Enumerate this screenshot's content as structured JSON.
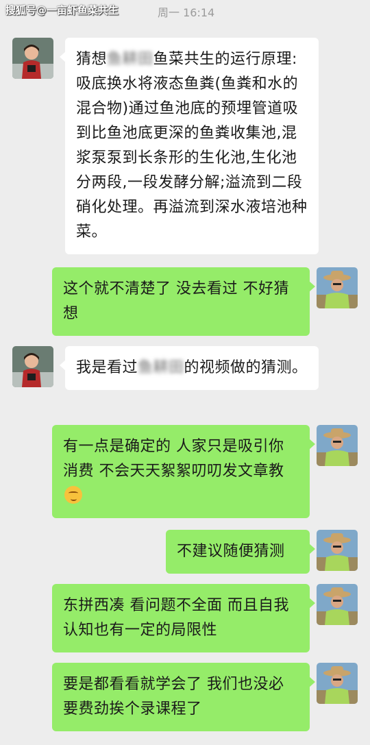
{
  "header": {
    "watermark": "搜狐号@一亩虾鱼菜共生",
    "timestamp": "周一 16:14"
  },
  "messages": [
    {
      "side": "left",
      "avatar": "child-avatar",
      "text_before": "猜想",
      "blurred": "鱼耕田",
      "text_after": "鱼菜共生的运行原理:吸底换水将液态鱼粪(鱼粪和水的混合物)通过鱼池底的预埋管道吸到比鱼池底更深的鱼粪收集池,混浆泵泵到长条形的生化池,生化池分两段,一段发酵分解;溢流到二段硝化处理。再溢流到深水液培池种菜。"
    },
    {
      "side": "right",
      "avatar": "farmer-avatar",
      "text": "这个就不清楚了 没去看过 不好猜想"
    },
    {
      "side": "left",
      "avatar": "child-avatar",
      "text_before": "我是看过",
      "blurred": "鱼耕田",
      "text_after": "的视频做的猜测。"
    },
    {
      "side": "right",
      "avatar": "farmer-avatar",
      "text": "有一点是确定的 人家只是吸引你消费 不会天天絮絮叨叨发文章教",
      "emoji": "thinking-face-emoji"
    },
    {
      "side": "right",
      "avatar": "farmer-avatar",
      "text": "不建议随便猜测"
    },
    {
      "side": "right",
      "avatar": "farmer-avatar",
      "text": "东拼西凑 看问题不全面 而且自我认知也有一定的局限性"
    },
    {
      "side": "right",
      "avatar": "farmer-avatar",
      "text": "要是都看看就学会了 我们也没必要费劲挨个录课程了"
    }
  ],
  "colors": {
    "background": "#ededed",
    "incoming_bubble": "#ffffff",
    "outgoing_bubble": "#95ec69"
  }
}
